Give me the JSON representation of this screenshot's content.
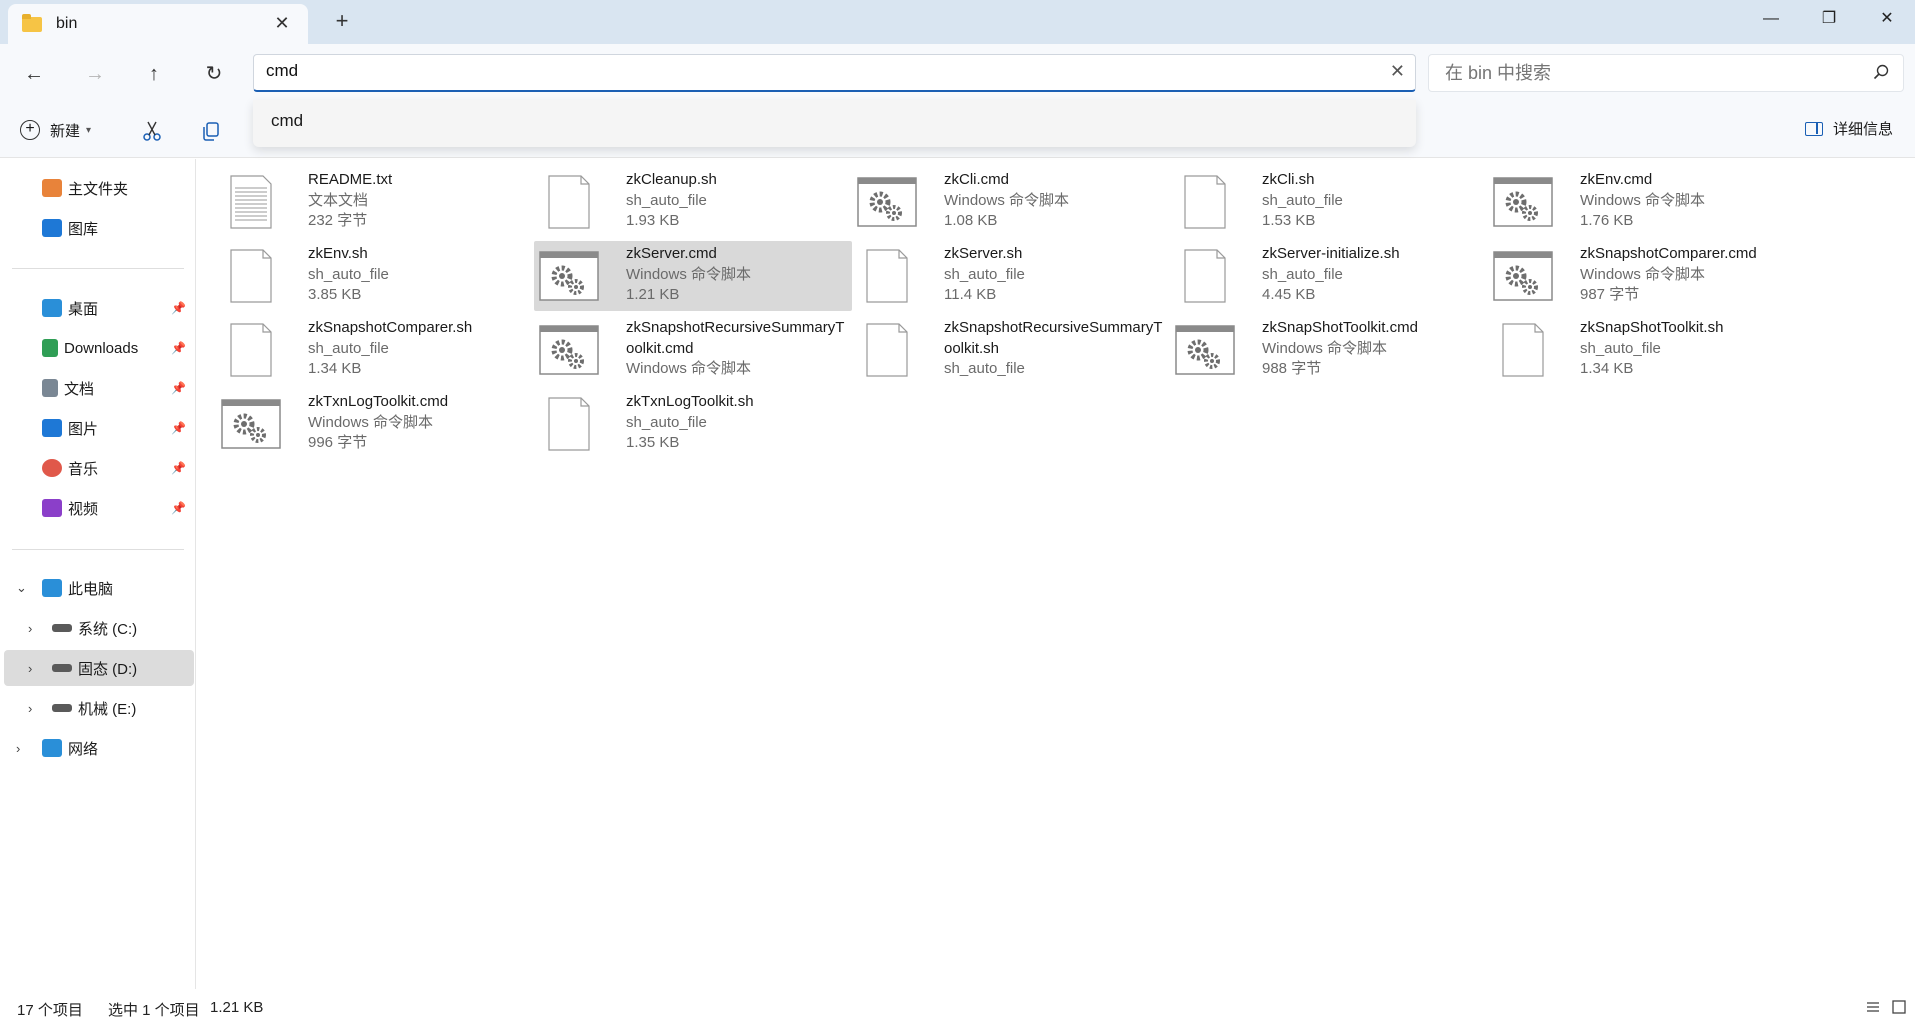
{
  "tab": {
    "title": "bin",
    "close_icon": "close-icon",
    "new_tab_icon": "plus-icon"
  },
  "window_controls": {
    "minimize": "—",
    "restore": "❐",
    "close": "✕"
  },
  "nav": {
    "back": "←",
    "forward": "→",
    "up": "↑",
    "refresh": "↻"
  },
  "address": {
    "value": "cmd",
    "clear": "✕"
  },
  "search": {
    "placeholder": "在 bin 中搜索"
  },
  "autocomplete": {
    "items": [
      "cmd"
    ]
  },
  "toolbar": {
    "new_label": "新建",
    "details_label": "详细信息"
  },
  "sidebar": {
    "quick": [
      {
        "label": "主文件夹",
        "icon": "home-icon",
        "color": "#e8833a"
      },
      {
        "label": "图库",
        "icon": "gallery-icon",
        "color": "#1e78d6"
      }
    ],
    "pinned": [
      {
        "label": "桌面",
        "icon": "desktop-icon",
        "color": "#2a8fd8"
      },
      {
        "label": "Downloads",
        "icon": "download-icon",
        "color": "#2f9e55"
      },
      {
        "label": "文档",
        "icon": "document-icon",
        "color": "#7a8794"
      },
      {
        "label": "图片",
        "icon": "pictures-icon",
        "color": "#1e78d6"
      },
      {
        "label": "音乐",
        "icon": "music-icon",
        "color": "#e0584a"
      },
      {
        "label": "视频",
        "icon": "video-icon",
        "color": "#8b3fc9"
      }
    ],
    "this_pc": {
      "label": "此电脑",
      "icon": "computer-icon",
      "color": "#2a8fd8"
    },
    "drives": [
      {
        "label": "系统 (C:)",
        "icon": "drive-c-icon"
      },
      {
        "label": "固态 (D:)",
        "icon": "drive-d-icon"
      },
      {
        "label": "机械 (E:)",
        "icon": "drive-e-icon"
      }
    ],
    "network": {
      "label": "网络",
      "icon": "network-icon",
      "color": "#2a8fd8"
    }
  },
  "files": [
    {
      "name": "README.txt",
      "type": "文本文档",
      "size": "232 字节",
      "icon": "text-file-icon"
    },
    {
      "name": "zkCleanup.sh",
      "type": "sh_auto_file",
      "size": "1.93 KB",
      "icon": "blank-file-icon"
    },
    {
      "name": "zkCli.cmd",
      "type": "Windows 命令脚本",
      "size": "1.08 KB",
      "icon": "cmd-script-icon"
    },
    {
      "name": "zkCli.sh",
      "type": "sh_auto_file",
      "size": "1.53 KB",
      "icon": "blank-file-icon"
    },
    {
      "name": "zkEnv.cmd",
      "type": "Windows 命令脚本",
      "size": "1.76 KB",
      "icon": "cmd-script-icon"
    },
    {
      "name": "zkEnv.sh",
      "type": "sh_auto_file",
      "size": "3.85 KB",
      "icon": "blank-file-icon"
    },
    {
      "name": "zkServer.cmd",
      "type": "Windows 命令脚本",
      "size": "1.21 KB",
      "icon": "cmd-script-icon",
      "selected": true
    },
    {
      "name": "zkServer.sh",
      "type": "sh_auto_file",
      "size": "11.4 KB",
      "icon": "blank-file-icon"
    },
    {
      "name": "zkServer-initialize.sh",
      "type": "sh_auto_file",
      "size": "4.45 KB",
      "icon": "blank-file-icon"
    },
    {
      "name": "zkSnapshotComparer.cmd",
      "type": "Windows 命令脚本",
      "size": "987 字节",
      "icon": "cmd-script-icon"
    },
    {
      "name": "zkSnapshotComparer.sh",
      "type": "sh_auto_file",
      "size": "1.34 KB",
      "icon": "blank-file-icon"
    },
    {
      "name": "zkSnapshotRecursiveSummaryToolkit.cmd",
      "type": "Windows 命令脚本",
      "size": "",
      "icon": "cmd-script-icon"
    },
    {
      "name": "zkSnapshotRecursiveSummaryToolkit.sh",
      "type": "sh_auto_file",
      "size": "",
      "icon": "blank-file-icon"
    },
    {
      "name": "zkSnapShotToolkit.cmd",
      "type": "Windows 命令脚本",
      "size": "988 字节",
      "icon": "cmd-script-icon"
    },
    {
      "name": "zkSnapShotToolkit.sh",
      "type": "sh_auto_file",
      "size": "1.34 KB",
      "icon": "blank-file-icon"
    },
    {
      "name": "zkTxnLogToolkit.cmd",
      "type": "Windows 命令脚本",
      "size": "996 字节",
      "icon": "cmd-script-icon"
    },
    {
      "name": "zkTxnLogToolkit.sh",
      "type": "sh_auto_file",
      "size": "1.35 KB",
      "icon": "blank-file-icon"
    }
  ],
  "status": {
    "count": "17 个项目",
    "selected": "选中 1 个项目",
    "size": "1.21 KB"
  },
  "colors": {
    "accent": "#1a5fb4",
    "tabbar": "#d9e5f1",
    "selection": "#d9d9d9"
  }
}
